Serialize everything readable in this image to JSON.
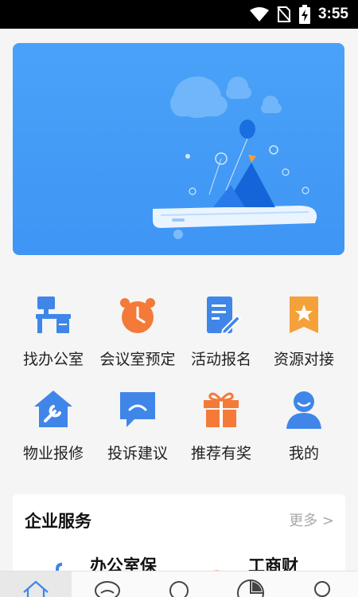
{
  "status_bar": {
    "time": "3:55",
    "icons": [
      "wifi-icon",
      "no-sim-icon",
      "battery-charging-icon"
    ]
  },
  "banner": {
    "illustration": "phone-with-mountains-and-clouds"
  },
  "quick_actions": [
    {
      "label": "找办公室",
      "icon": "office-desk-icon",
      "color": "#3f86e8"
    },
    {
      "label": "会议室预定",
      "icon": "alarm-clock-icon",
      "color": "#f47a3a"
    },
    {
      "label": "活动报名",
      "icon": "document-edit-icon",
      "color": "#3f86e8"
    },
    {
      "label": "资源对接",
      "icon": "star-bookmark-icon",
      "color": "#f4a13a"
    },
    {
      "label": "物业报修",
      "icon": "house-wrench-icon",
      "color": "#3f86e8"
    },
    {
      "label": "投诉建议",
      "icon": "chat-bubble-icon",
      "color": "#3f86e8"
    },
    {
      "label": "推荐有奖",
      "icon": "gift-box-icon",
      "color": "#f47a3a"
    },
    {
      "label": "我的",
      "icon": "user-icon",
      "color": "#3f86e8"
    }
  ],
  "services": {
    "title": "企业服务",
    "more": "更多 >",
    "items": [
      "办公室保",
      "工商财"
    ]
  },
  "tab_bar": {
    "tabs": [
      "home-icon",
      "chat-icon",
      "discover-icon",
      "stats-icon",
      "profile-icon"
    ]
  },
  "colors": {
    "primary": "#3f86e8",
    "accent": "#f47a3a",
    "banner": "#4aa2f8"
  }
}
